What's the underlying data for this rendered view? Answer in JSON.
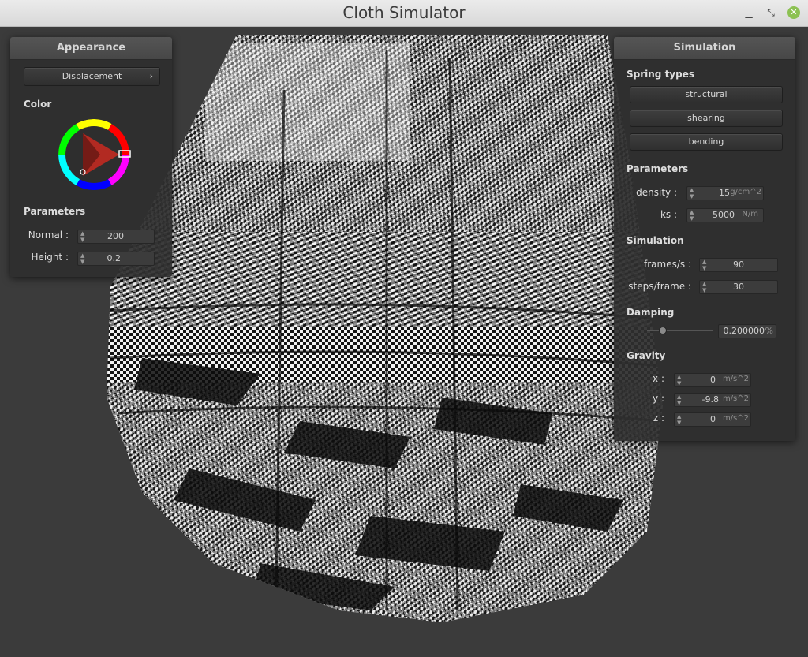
{
  "window": {
    "title": "Cloth Simulator"
  },
  "appearance": {
    "header": "Appearance",
    "shader_dropdown": "Displacement",
    "color_label": "Color",
    "parameters_label": "Parameters",
    "normal": {
      "label": "Normal :",
      "value": "200"
    },
    "height": {
      "label": "Height :",
      "value": "0.2"
    },
    "selected_color": "#c0392b"
  },
  "simulation": {
    "header": "Simulation",
    "spring_types_label": "Spring types",
    "spring_types": [
      "structural",
      "shearing",
      "bending"
    ],
    "parameters_label": "Parameters",
    "density": {
      "label": "density :",
      "value": "15",
      "unit": "g/cm^2"
    },
    "ks": {
      "label": "ks :",
      "value": "5000",
      "unit": "N/m"
    },
    "simulation_label": "Simulation",
    "frames": {
      "label": "frames/s :",
      "value": "90"
    },
    "steps": {
      "label": "steps/frame :",
      "value": "30"
    },
    "damping_label": "Damping",
    "damping": {
      "value": "0.200000",
      "unit": "%",
      "slider_fraction": 0.2
    },
    "gravity_label": "Gravity",
    "gravity": {
      "x": {
        "label": "x :",
        "value": "0",
        "unit": "m/s^2"
      },
      "y": {
        "label": "y :",
        "value": "-9.8",
        "unit": "m/s^2"
      },
      "z": {
        "label": "z :",
        "value": "0",
        "unit": "m/s^2"
      }
    }
  }
}
